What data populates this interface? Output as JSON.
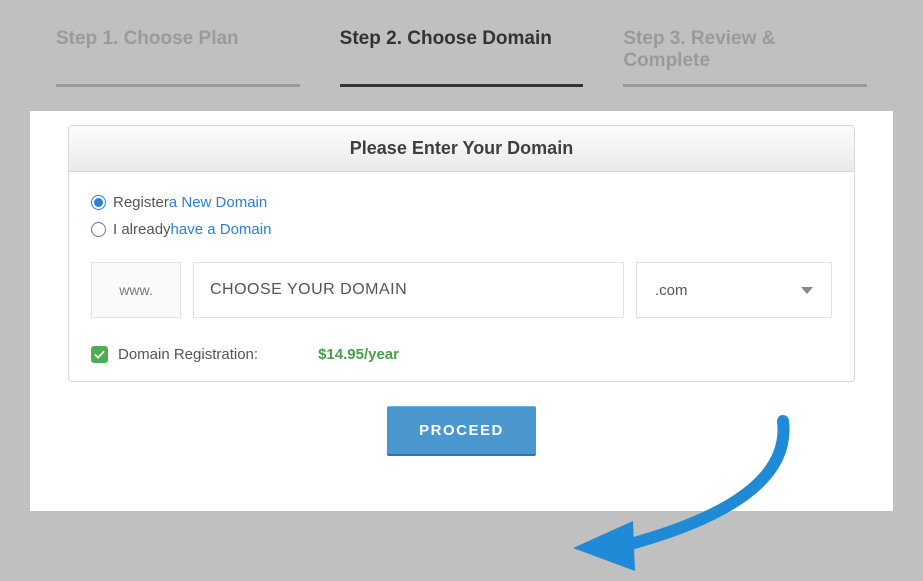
{
  "steps": {
    "step1": "Step 1. Choose Plan",
    "step2": "Step 2. Choose Domain",
    "step3": "Step 3. Review & Complete"
  },
  "panel": {
    "title": "Please Enter Your Domain"
  },
  "radio": {
    "register_prefix": "Register ",
    "register_link": "a New Domain",
    "have_prefix": "I already ",
    "have_link": "have a Domain"
  },
  "domain": {
    "prefix": "www.",
    "value": "CHOOSE YOUR DOMAIN",
    "tld": ".com"
  },
  "registration": {
    "label": "Domain Registration:",
    "price": "$14.95/year"
  },
  "proceed": "PROCEED",
  "colors": {
    "accent": "#4a96cf",
    "link": "#2a7fd8",
    "success": "#46a049"
  }
}
